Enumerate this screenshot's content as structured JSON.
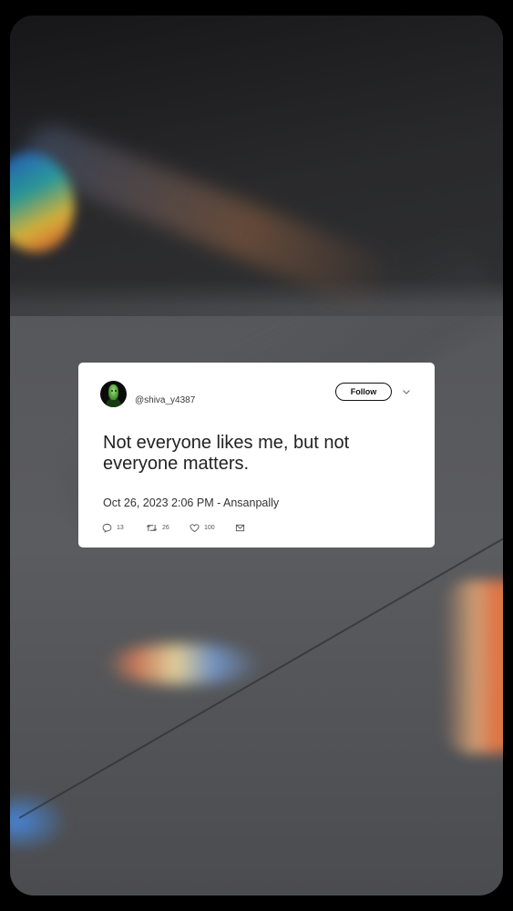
{
  "tweet": {
    "handle": "@shiva_y4387",
    "follow_label": "Follow",
    "text": "Not everyone likes me, but not everyone matters.",
    "meta": "Oct 26, 2023 2:06 PM - Ansanpally",
    "replies": "13",
    "retweets": "26",
    "likes": "100"
  },
  "icons": {
    "avatar": "avatar-image",
    "chevron": "chevron-down-icon",
    "reply": "reply-icon",
    "retweet": "retweet-icon",
    "like": "heart-icon",
    "share": "envelope-icon"
  },
  "colors": {
    "card_background": "#ffffff",
    "text": "#222222",
    "page_background": "#000000"
  }
}
